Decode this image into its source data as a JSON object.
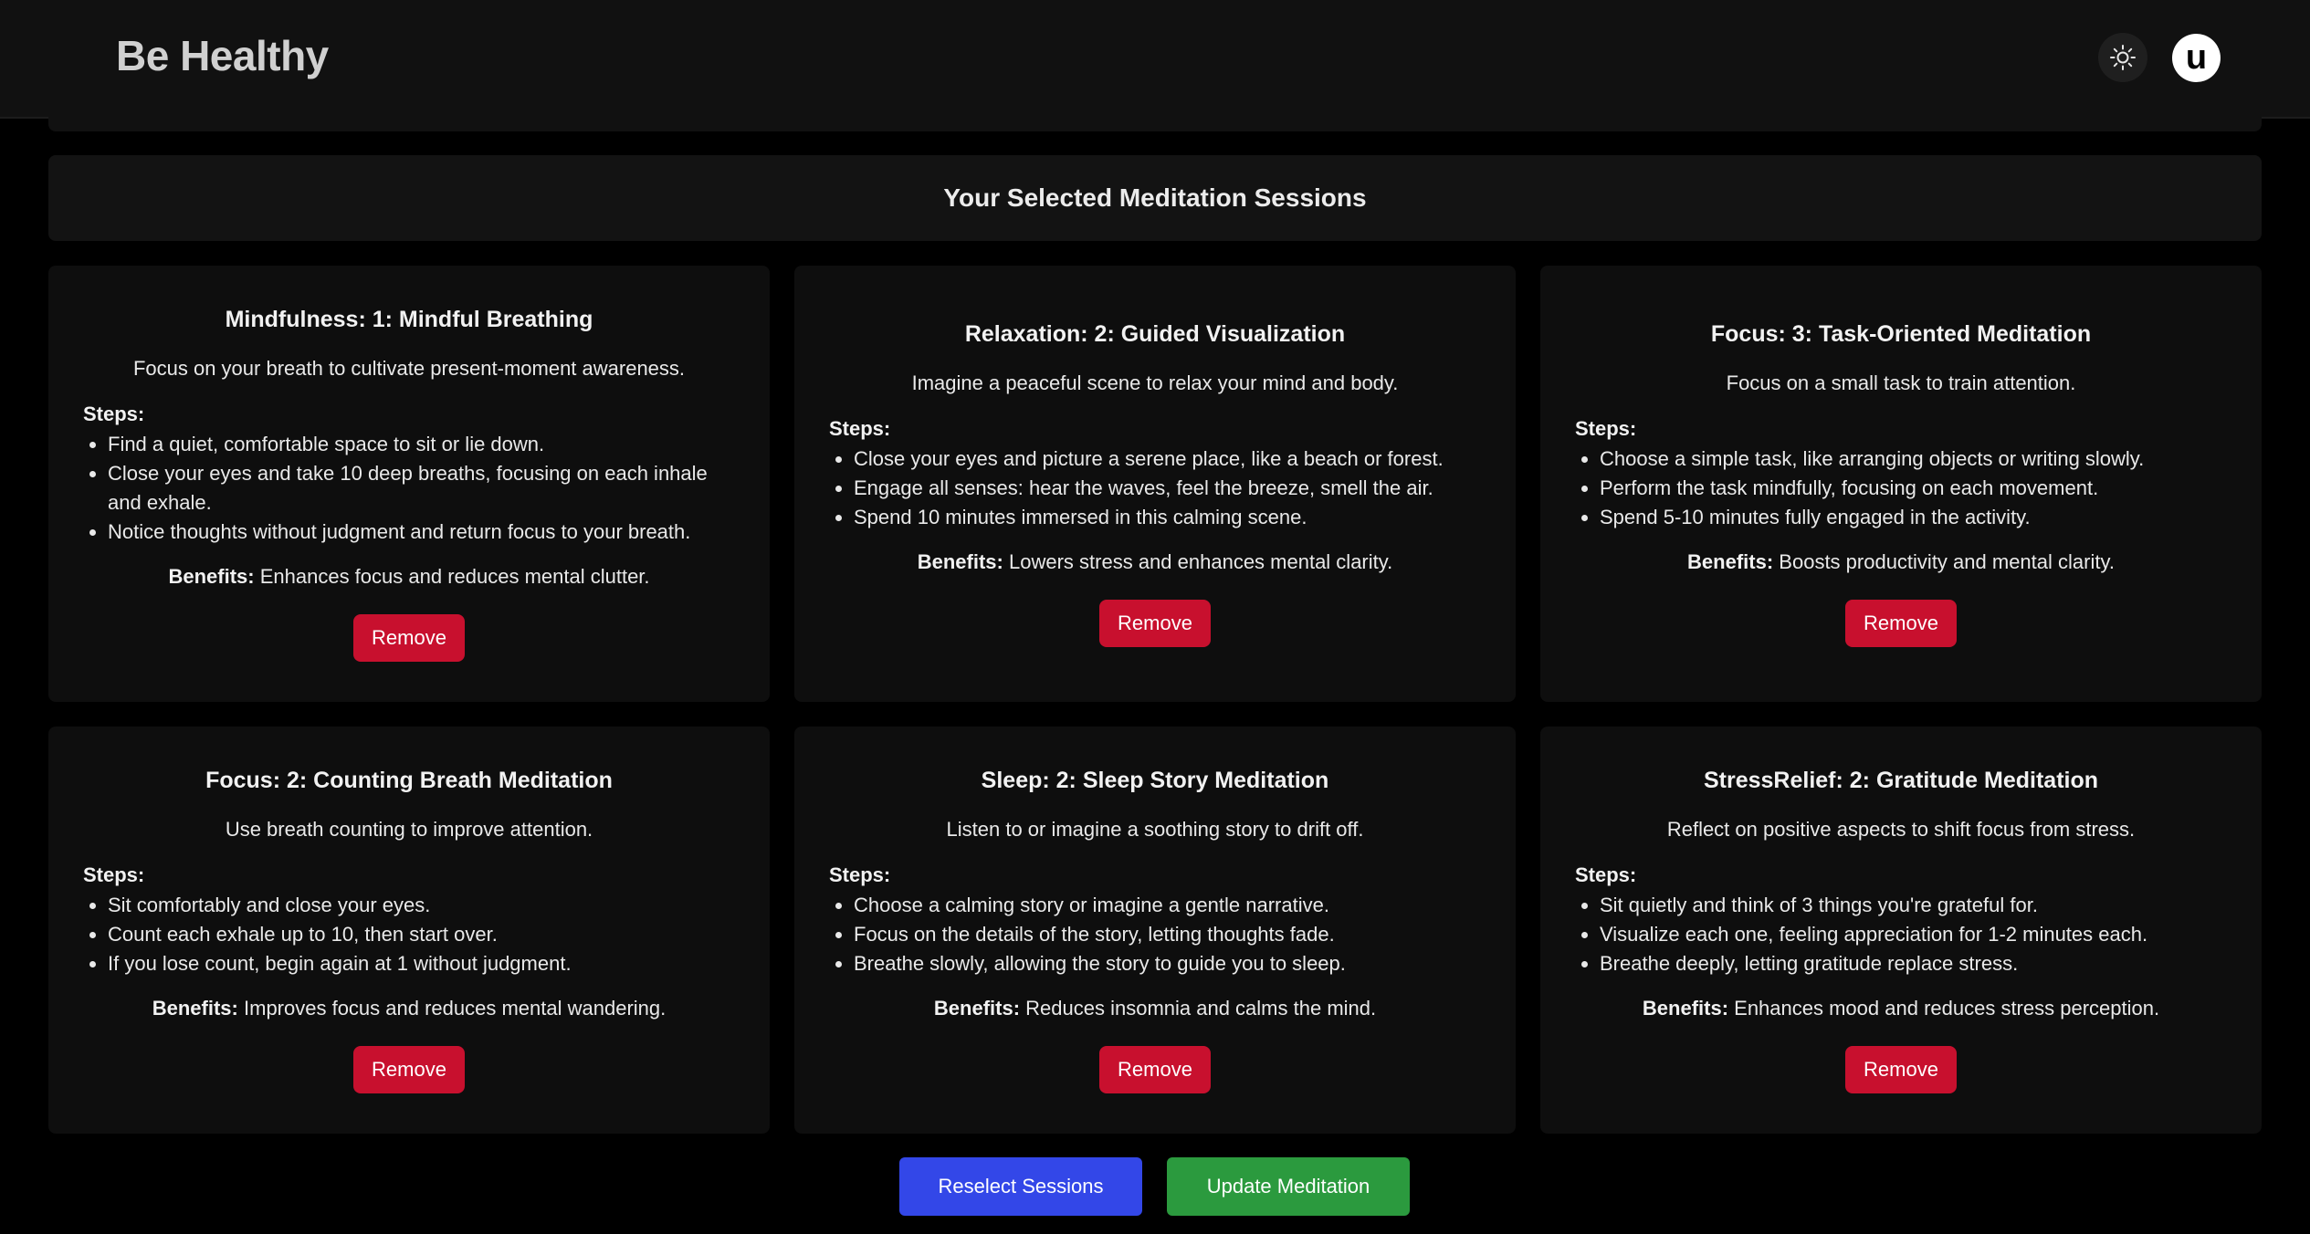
{
  "app": {
    "title": "Be Healthy",
    "user_initial": "u"
  },
  "section": {
    "title": "Your Selected Meditation Sessions"
  },
  "labels": {
    "steps": "Steps:",
    "benefits": "Benefits:",
    "remove": "Remove"
  },
  "sessions": [
    {
      "title": "Mindfulness: 1: Mindful Breathing",
      "description": "Focus on your breath to cultivate present-moment awareness.",
      "steps": [
        "Find a quiet, comfortable space to sit or lie down.",
        "Close your eyes and take 10 deep breaths, focusing on each inhale and exhale.",
        "Notice thoughts without judgment and return focus to your breath."
      ],
      "benefits": "Enhances focus and reduces mental clutter."
    },
    {
      "title": "Relaxation: 2: Guided Visualization",
      "description": "Imagine a peaceful scene to relax your mind and body.",
      "steps": [
        "Close your eyes and picture a serene place, like a beach or forest.",
        "Engage all senses: hear the waves, feel the breeze, smell the air.",
        "Spend 10 minutes immersed in this calming scene."
      ],
      "benefits": "Lowers stress and enhances mental clarity."
    },
    {
      "title": "Focus: 3: Task-Oriented Meditation",
      "description": "Focus on a small task to train attention.",
      "steps": [
        "Choose a simple task, like arranging objects or writing slowly.",
        "Perform the task mindfully, focusing on each movement.",
        "Spend 5-10 minutes fully engaged in the activity."
      ],
      "benefits": "Boosts productivity and mental clarity."
    },
    {
      "title": "Focus: 2: Counting Breath Meditation",
      "description": "Use breath counting to improve attention.",
      "steps": [
        "Sit comfortably and close your eyes.",
        "Count each exhale up to 10, then start over.",
        "If you lose count, begin again at 1 without judgment."
      ],
      "benefits": "Improves focus and reduces mental wandering."
    },
    {
      "title": "Sleep: 2: Sleep Story Meditation",
      "description": "Listen to or imagine a soothing story to drift off.",
      "steps": [
        "Choose a calming story or imagine a gentle narrative.",
        "Focus on the details of the story, letting thoughts fade.",
        "Breathe slowly, allowing the story to guide you to sleep."
      ],
      "benefits": "Reduces insomnia and calms the mind."
    },
    {
      "title": "StressRelief: 2: Gratitude Meditation",
      "description": "Reflect on positive aspects to shift focus from stress.",
      "steps": [
        "Sit quietly and think of 3 things you're grateful for.",
        "Visualize each one, feeling appreciation for 1-2 minutes each.",
        "Breathe deeply, letting gratitude replace stress."
      ],
      "benefits": "Enhances mood and reduces stress perception."
    }
  ],
  "actions": {
    "reselect": {
      "label": "Reselect Sessions",
      "color": "#3347e8"
    },
    "update": {
      "label": "Update Meditation",
      "color": "#2b9a3e"
    }
  },
  "colors": {
    "remove": "#c8102e",
    "background": "#000000",
    "surface": "#0e0e0e"
  }
}
